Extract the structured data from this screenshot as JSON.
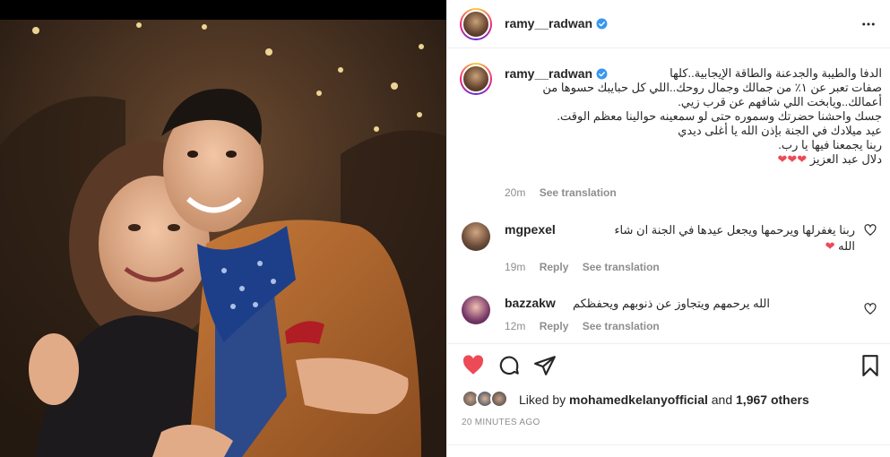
{
  "post": {
    "author": "ramy__radwan",
    "verified": true
  },
  "caption": {
    "author": "ramy__radwan",
    "lines": [
      "الدفا والطيبة والجدعنة والطاقة الإيجابية..كلها",
      "صفات تعبر عن ١٪ من جمالك وجمال روحك..اللي كل حبايبك حسوها من",
      "أعمالك..ويابخت اللي شافهم عن قرب زيي.",
      "جسك واحشنا حضرتك وسموره حتى لو سمعينه حوالينا معظم الوقت.",
      "عيد ميلادك في الجنة بإذن الله يا أغلى ديدي",
      "ربنا يجمعنا فيها يا رب.",
      "دلال عبد العزيز"
    ],
    "hearts": "❤❤❤",
    "age": "20m",
    "see_translation": "See translation"
  },
  "comments": [
    {
      "user": "mgpexel",
      "text": "ربنا يغفرلها ويرحمها ويجعل عيدها في الجنة ان شاء الله",
      "emoji": "❤",
      "age": "19m",
      "reply": "Reply",
      "see_translation": "See translation"
    },
    {
      "user": "bazzakw",
      "text": "الله يرحمهم ويتجاوز عن ذنوبهم ويحفظكم",
      "age": "12m",
      "reply": "Reply",
      "see_translation": "See translation"
    }
  ],
  "likes": {
    "prefix": "Liked by ",
    "user": "mohamedkelanyofficial",
    "middle": " and ",
    "count": "1,967 others"
  },
  "timestamp": "20 MINUTES AGO",
  "icons": [
    "heart-filled-icon",
    "comment-icon",
    "share-icon",
    "bookmark-icon",
    "more-icon",
    "verified-icon"
  ],
  "colors": {
    "like": "#ed4956",
    "verified": "#3897f0",
    "muted": "#8e8e8e",
    "text": "#262626"
  }
}
